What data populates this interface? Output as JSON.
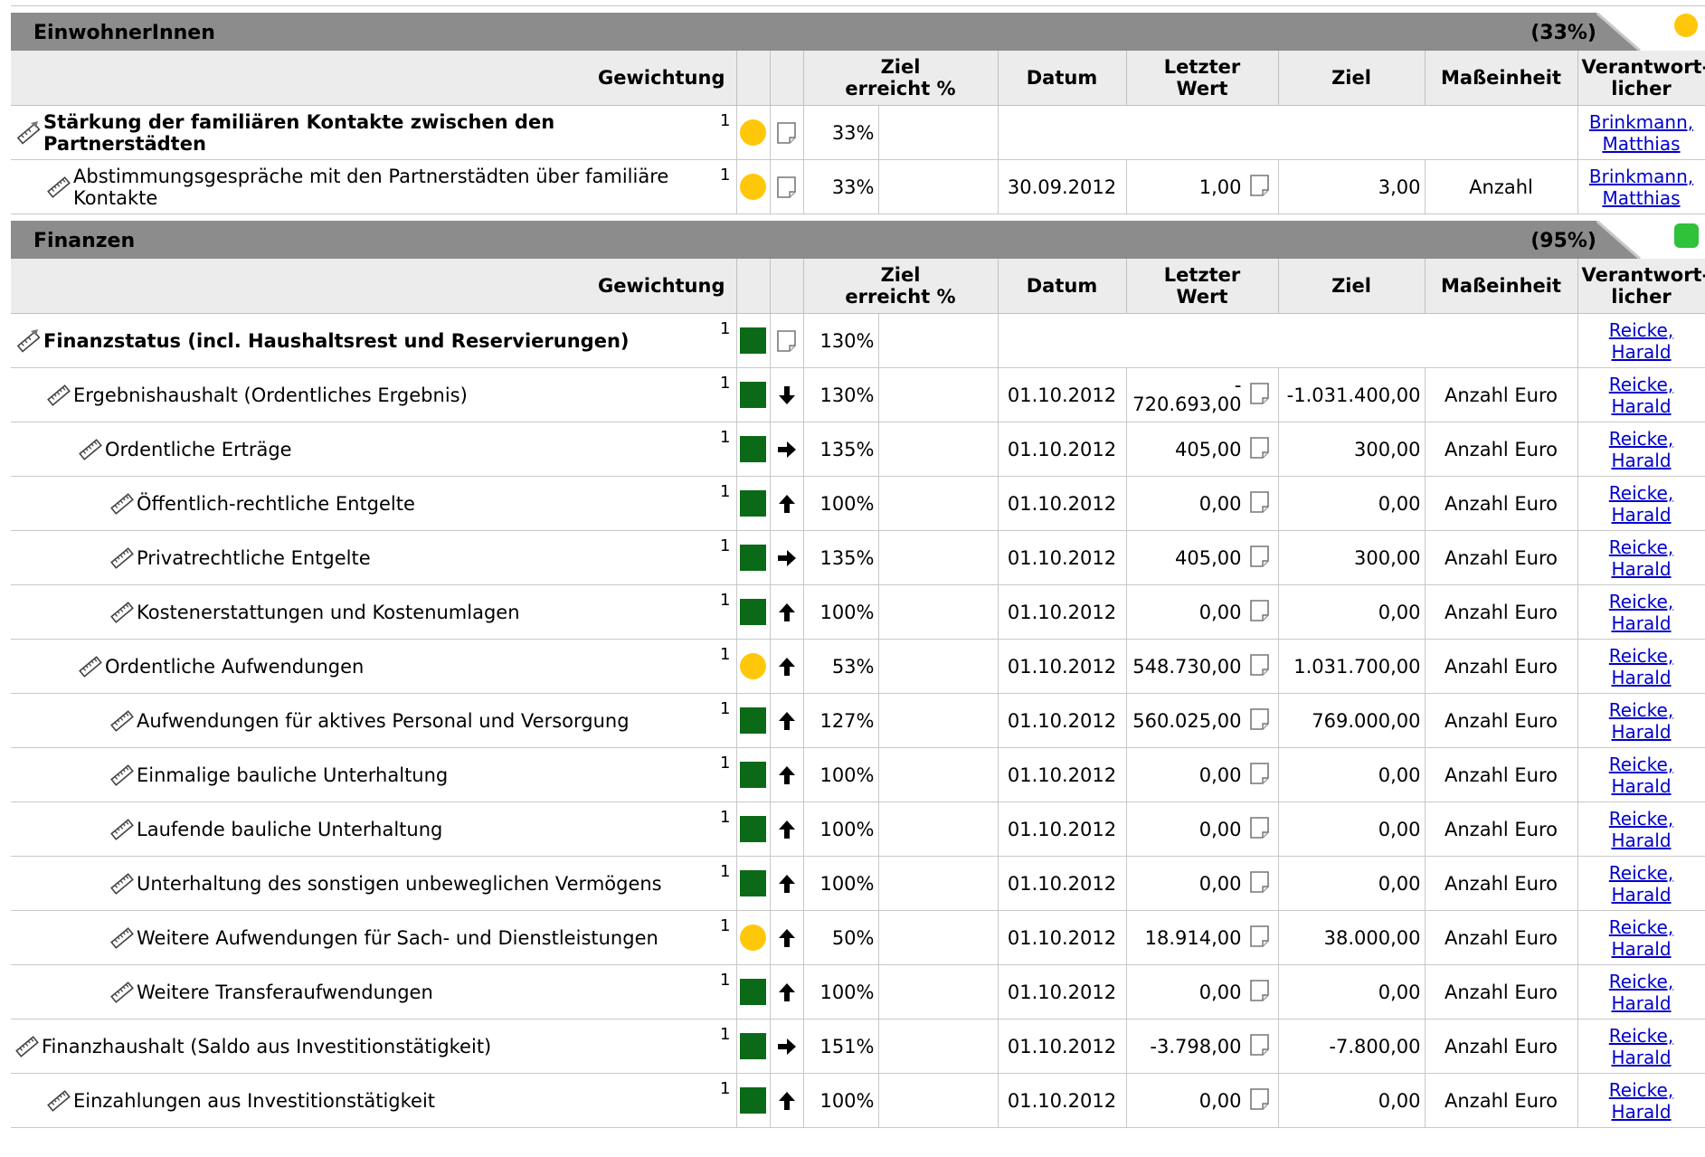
{
  "columns": {
    "gewichtung": "Gewichtung",
    "ziel_erreicht": [
      "Ziel",
      "erreicht %"
    ],
    "datum": "Datum",
    "letzter_wert": [
      "Letzter",
      "Wert"
    ],
    "ziel": "Ziel",
    "masseinheit": "Maßeinheit",
    "verantwortlicher": [
      "Verantwort-",
      "licher"
    ]
  },
  "colors": {
    "green": "#0b6a18",
    "yellow": "#ffc70a",
    "header_gray": "#8c8c8c",
    "link": "#0000cc"
  },
  "sections": [
    {
      "title": "EinwohnerInnen",
      "pct": "(33%)",
      "status": "yellow",
      "rows": [
        {
          "type": "goal",
          "name": "Stärkung der familiären Kontakte zwischen den Partnerstädten",
          "weight": "1",
          "lamp": "yellow",
          "trend": "",
          "pct": "33%",
          "resp": [
            "Brinkmann,",
            "Matthias"
          ]
        },
        {
          "type": "measure",
          "indent": 1,
          "name": "Abstimmungsgespräche mit den Partnerstädten über familiäre Kontakte",
          "weight": "1",
          "lamp": "yellow",
          "trend": "",
          "pct": "33%",
          "datum": "30.09.2012",
          "letzter": "1,00",
          "ziel": "3,00",
          "einheit": "Anzahl",
          "resp": [
            "Brinkmann,",
            "Matthias"
          ]
        }
      ]
    },
    {
      "title": "Finanzen",
      "pct": "(95%)",
      "status": "green",
      "rows": [
        {
          "type": "goal",
          "name": "Finanzstatus (incl. Haushaltsrest und Reservierungen)",
          "weight": "1",
          "lamp": "green",
          "trend": "",
          "pct": "130%",
          "resp": [
            "Reicke,",
            "Harald"
          ]
        },
        {
          "type": "measure",
          "indent": 1,
          "name": "Ergebnishaushalt (Ordentliches Ergebnis)",
          "weight": "1",
          "lamp": "green",
          "trend": "down",
          "pct": "130%",
          "datum": "01.10.2012",
          "letzter": "-",
          "letzter2": "720.693,00",
          "ziel": "-1.031.400,00",
          "einheit": "Anzahl Euro",
          "resp": [
            "Reicke,",
            "Harald"
          ]
        },
        {
          "type": "measure",
          "indent": 2,
          "name": "Ordentliche Erträge",
          "weight": "1",
          "lamp": "green",
          "trend": "right",
          "pct": "135%",
          "datum": "01.10.2012",
          "letzter": "405,00",
          "ziel": "300,00",
          "einheit": "Anzahl Euro",
          "resp": [
            "Reicke,",
            "Harald"
          ]
        },
        {
          "type": "measure",
          "indent": 3,
          "name": "Öffentlich-rechtliche Entgelte",
          "weight": "1",
          "lamp": "green",
          "trend": "up",
          "pct": "100%",
          "datum": "01.10.2012",
          "letzter": "0,00",
          "ziel": "0,00",
          "einheit": "Anzahl Euro",
          "resp": [
            "Reicke,",
            "Harald"
          ]
        },
        {
          "type": "measure",
          "indent": 3,
          "name": "Privatrechtliche Entgelte",
          "weight": "1",
          "lamp": "green",
          "trend": "right",
          "pct": "135%",
          "datum": "01.10.2012",
          "letzter": "405,00",
          "ziel": "300,00",
          "einheit": "Anzahl Euro",
          "resp": [
            "Reicke,",
            "Harald"
          ]
        },
        {
          "type": "measure",
          "indent": 3,
          "name": "Kostenerstattungen und Kostenumlagen",
          "weight": "1",
          "lamp": "green",
          "trend": "up",
          "pct": "100%",
          "datum": "01.10.2012",
          "letzter": "0,00",
          "ziel": "0,00",
          "einheit": "Anzahl Euro",
          "resp": [
            "Reicke,",
            "Harald"
          ]
        },
        {
          "type": "measure",
          "indent": 2,
          "name": "Ordentliche Aufwendungen",
          "weight": "1",
          "lamp": "yellow",
          "trend": "up",
          "pct": "53%",
          "datum": "01.10.2012",
          "letzter": "548.730,00",
          "ziel": "1.031.700,00",
          "einheit": "Anzahl Euro",
          "resp": [
            "Reicke,",
            "Harald"
          ]
        },
        {
          "type": "measure",
          "indent": 3,
          "name": "Aufwendungen für aktives Personal und Versorgung",
          "weight": "1",
          "lamp": "green",
          "trend": "up",
          "pct": "127%",
          "datum": "01.10.2012",
          "letzter": "560.025,00",
          "ziel": "769.000,00",
          "einheit": "Anzahl Euro",
          "resp": [
            "Reicke,",
            "Harald"
          ]
        },
        {
          "type": "measure",
          "indent": 3,
          "name": "Einmalige bauliche Unterhaltung",
          "weight": "1",
          "lamp": "green",
          "trend": "up",
          "pct": "100%",
          "datum": "01.10.2012",
          "letzter": "0,00",
          "ziel": "0,00",
          "einheit": "Anzahl Euro",
          "resp": [
            "Reicke,",
            "Harald"
          ]
        },
        {
          "type": "measure",
          "indent": 3,
          "name": "Laufende bauliche Unterhaltung",
          "weight": "1",
          "lamp": "green",
          "trend": "up",
          "pct": "100%",
          "datum": "01.10.2012",
          "letzter": "0,00",
          "ziel": "0,00",
          "einheit": "Anzahl Euro",
          "resp": [
            "Reicke,",
            "Harald"
          ]
        },
        {
          "type": "measure",
          "indent": 3,
          "name": "Unterhaltung des sonstigen unbeweglichen Vermögens",
          "weight": "1",
          "lamp": "green",
          "trend": "up",
          "pct": "100%",
          "datum": "01.10.2012",
          "letzter": "0,00",
          "ziel": "0,00",
          "einheit": "Anzahl Euro",
          "resp": [
            "Reicke,",
            "Harald"
          ]
        },
        {
          "type": "measure",
          "indent": 3,
          "name": "Weitere Aufwendungen für Sach- und Dienstleistungen",
          "weight": "1",
          "lamp": "yellow",
          "trend": "up",
          "pct": "50%",
          "datum": "01.10.2012",
          "letzter": "18.914,00",
          "ziel": "38.000,00",
          "einheit": "Anzahl Euro",
          "resp": [
            "Reicke,",
            "Harald"
          ]
        },
        {
          "type": "measure",
          "indent": 3,
          "name": "Weitere Transferaufwendungen",
          "weight": "1",
          "lamp": "green",
          "trend": "up",
          "pct": "100%",
          "datum": "01.10.2012",
          "letzter": "0,00",
          "ziel": "0,00",
          "einheit": "Anzahl Euro",
          "resp": [
            "Reicke,",
            "Harald"
          ]
        },
        {
          "type": "measure",
          "indent": 0,
          "name": "Finanzhaushalt (Saldo aus Investitionstätigkeit)",
          "weight": "1",
          "lamp": "green",
          "trend": "right",
          "pct": "151%",
          "datum": "01.10.2012",
          "letzter": "-3.798,00",
          "ziel": "-7.800,00",
          "einheit": "Anzahl Euro",
          "resp": [
            "Reicke,",
            "Harald"
          ]
        },
        {
          "type": "measure",
          "indent": 1,
          "name": "Einzahlungen aus Investitionstätigkeit",
          "weight": "1",
          "lamp": "green",
          "trend": "up",
          "pct": "100%",
          "datum": "01.10.2012",
          "letzter": "0,00",
          "ziel": "0,00",
          "einheit": "Anzahl Euro",
          "resp": [
            "Reicke,",
            "Harald"
          ]
        }
      ]
    }
  ]
}
